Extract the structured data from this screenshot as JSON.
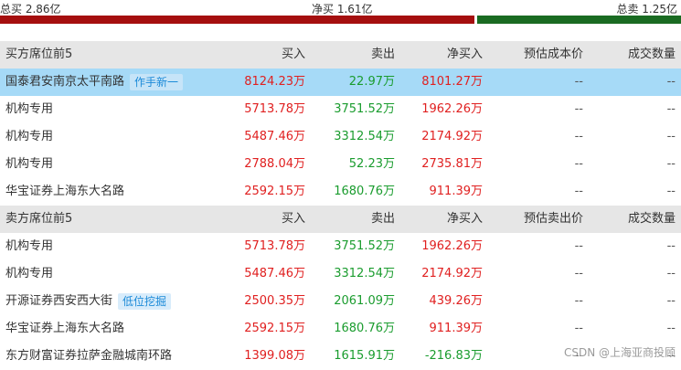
{
  "summary": {
    "total_buy": "总买 2.86亿",
    "net_buy": "净买 1.61亿",
    "total_sell": "总卖 1.25亿",
    "buy_ratio": 0.696,
    "buy_color": "#a50f0f",
    "sell_color": "#1a6b22"
  },
  "buy_table": {
    "headers": {
      "name": "买方席位前5",
      "buy": "买入",
      "sell": "卖出",
      "net": "净买入",
      "est": "预估成本价",
      "vol": "成交数量"
    },
    "rows": [
      {
        "name": "国泰君安南京太平南路",
        "tag": "作手新一",
        "buy": "8124.23万",
        "sell": "22.97万",
        "net": "8101.27万",
        "est": "--",
        "vol": "--",
        "highlight": true
      },
      {
        "name": "机构专用",
        "buy": "5713.78万",
        "sell": "3751.52万",
        "net": "1962.26万",
        "est": "--",
        "vol": "--"
      },
      {
        "name": "机构专用",
        "buy": "5487.46万",
        "sell": "3312.54万",
        "net": "2174.92万",
        "est": "--",
        "vol": "--"
      },
      {
        "name": "机构专用",
        "buy": "2788.04万",
        "sell": "52.23万",
        "net": "2735.81万",
        "est": "--",
        "vol": "--"
      },
      {
        "name": "华宝证券上海东大名路",
        "buy": "2592.15万",
        "sell": "1680.76万",
        "net": "911.39万",
        "est": "--",
        "vol": "--"
      }
    ]
  },
  "sell_table": {
    "headers": {
      "name": "卖方席位前5",
      "buy": "买入",
      "sell": "卖出",
      "net": "净买入",
      "est": "预估卖出价",
      "vol": "成交数量"
    },
    "rows": [
      {
        "name": "机构专用",
        "buy": "5713.78万",
        "sell": "3751.52万",
        "net": "1962.26万",
        "est": "--",
        "vol": "--"
      },
      {
        "name": "机构专用",
        "buy": "5487.46万",
        "sell": "3312.54万",
        "net": "2174.92万",
        "est": "--",
        "vol": "--"
      },
      {
        "name": "开源证券西安西大街",
        "tag": "低位挖掘",
        "buy": "2500.35万",
        "sell": "2061.09万",
        "net": "439.26万",
        "est": "--",
        "vol": "--"
      },
      {
        "name": "华宝证券上海东大名路",
        "buy": "2592.15万",
        "sell": "1680.76万",
        "net": "911.39万",
        "est": "--",
        "vol": "--"
      },
      {
        "name": "东方财富证券拉萨金融城南环路",
        "buy": "1399.08万",
        "sell": "1615.91万",
        "net": "-216.83万",
        "est": "--",
        "vol": "--"
      }
    ]
  },
  "watermark": "CSDN @上海亚商投顾"
}
